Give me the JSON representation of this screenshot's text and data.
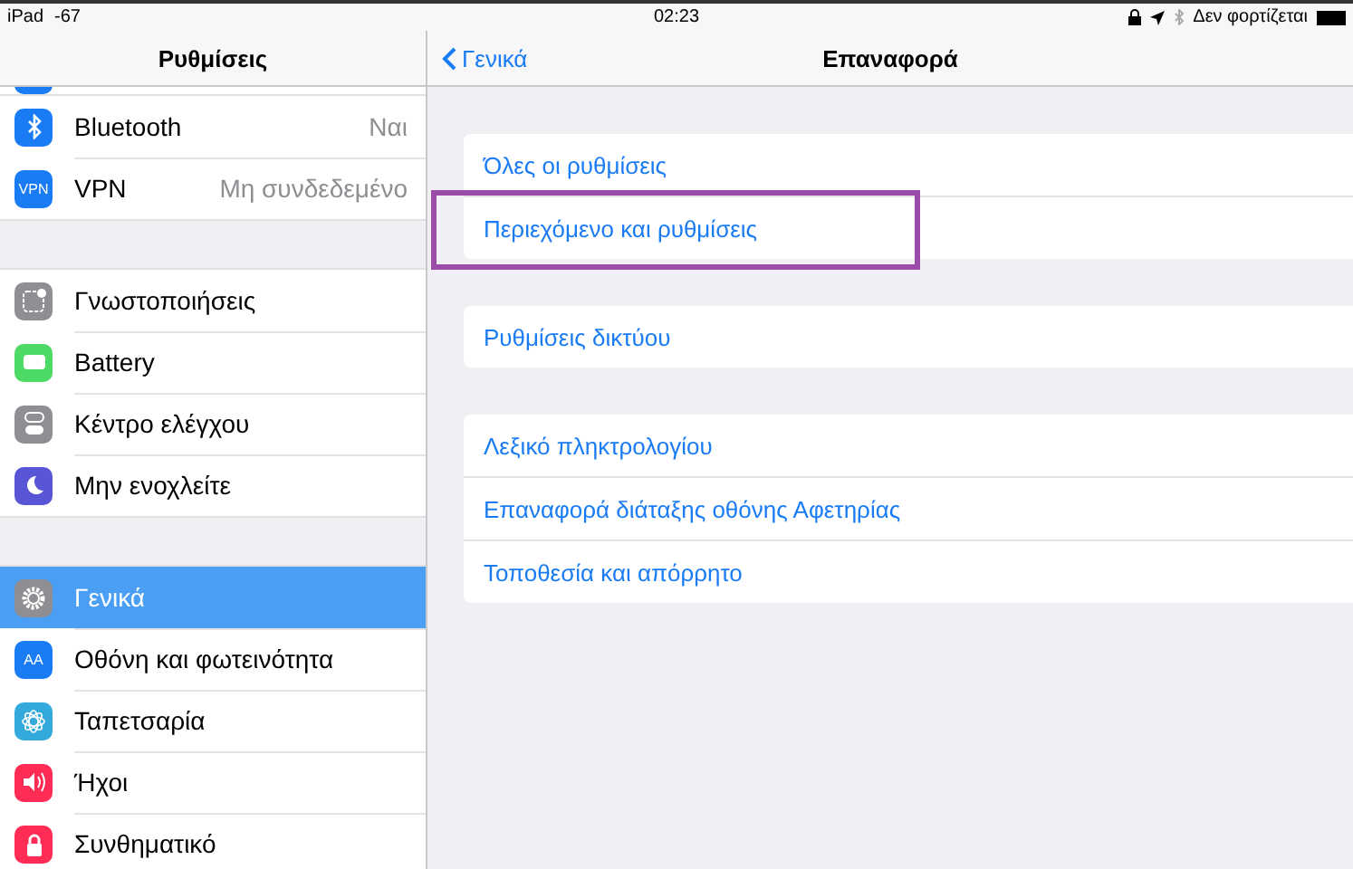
{
  "status_bar": {
    "device": "iPad",
    "signal": "-67",
    "time": "02:23",
    "battery_text": "Δεν φορτίζεται"
  },
  "sidebar": {
    "title": "Ρυθμίσεις",
    "groups": [
      [
        {
          "label": "Bluetooth",
          "value": "Ναι",
          "selected": false
        },
        {
          "label": "VPN",
          "value": "Μη συνδεδεμένο",
          "badge": "VPN",
          "selected": false
        }
      ],
      [
        {
          "label": "Γνωστοποιήσεις",
          "selected": false
        },
        {
          "label": "Battery",
          "selected": false
        },
        {
          "label": "Κέντρο ελέγχου",
          "selected": false
        },
        {
          "label": "Μην ενοχλείτε",
          "selected": false
        }
      ],
      [
        {
          "label": "Γενικά",
          "selected": true
        },
        {
          "label": "Οθόνη και φωτεινότητα",
          "badge": "AA",
          "selected": false
        },
        {
          "label": "Ταπετσαρία",
          "selected": false
        },
        {
          "label": "Ήχοι",
          "selected": false
        },
        {
          "label": "Συνθηματικό",
          "selected": false
        }
      ]
    ]
  },
  "detail": {
    "back": "Γενικά",
    "title": "Επαναφορά",
    "groups": [
      [
        {
          "label": "Όλες οι ρυθμίσεις",
          "highlighted": false
        },
        {
          "label": "Περιεχόμενο και ρυθμίσεις",
          "highlighted": true
        }
      ],
      [
        {
          "label": "Ρυθμίσεις δικτύου",
          "highlighted": false
        }
      ],
      [
        {
          "label": "Λεξικό πληκτρολογίου",
          "highlighted": false
        },
        {
          "label": "Επαναφορά διάταξης οθόνης Αφετηρίας",
          "highlighted": false
        },
        {
          "label": "Τοποθεσία και απόρρητο",
          "highlighted": false
        }
      ]
    ]
  }
}
